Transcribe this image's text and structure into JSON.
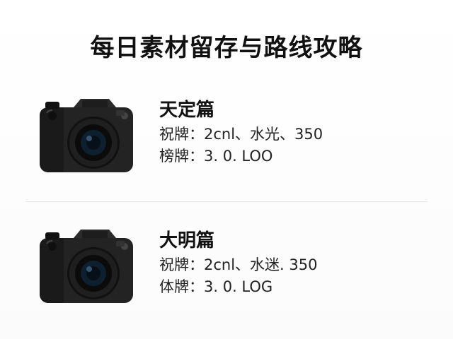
{
  "header": {
    "title": "每日素材留存与路线攻略"
  },
  "sections": [
    {
      "heading": "天定篇",
      "line1": "祝牌：2cnl、水光、350",
      "line2": "榜牌：3. 0. LOO",
      "icon": "camera-icon"
    },
    {
      "heading": "大明篇",
      "line1": "祝牌：2cnl、水迷. 350",
      "line2": "体牌：3. 0. LOG",
      "icon": "camera-icon"
    }
  ]
}
